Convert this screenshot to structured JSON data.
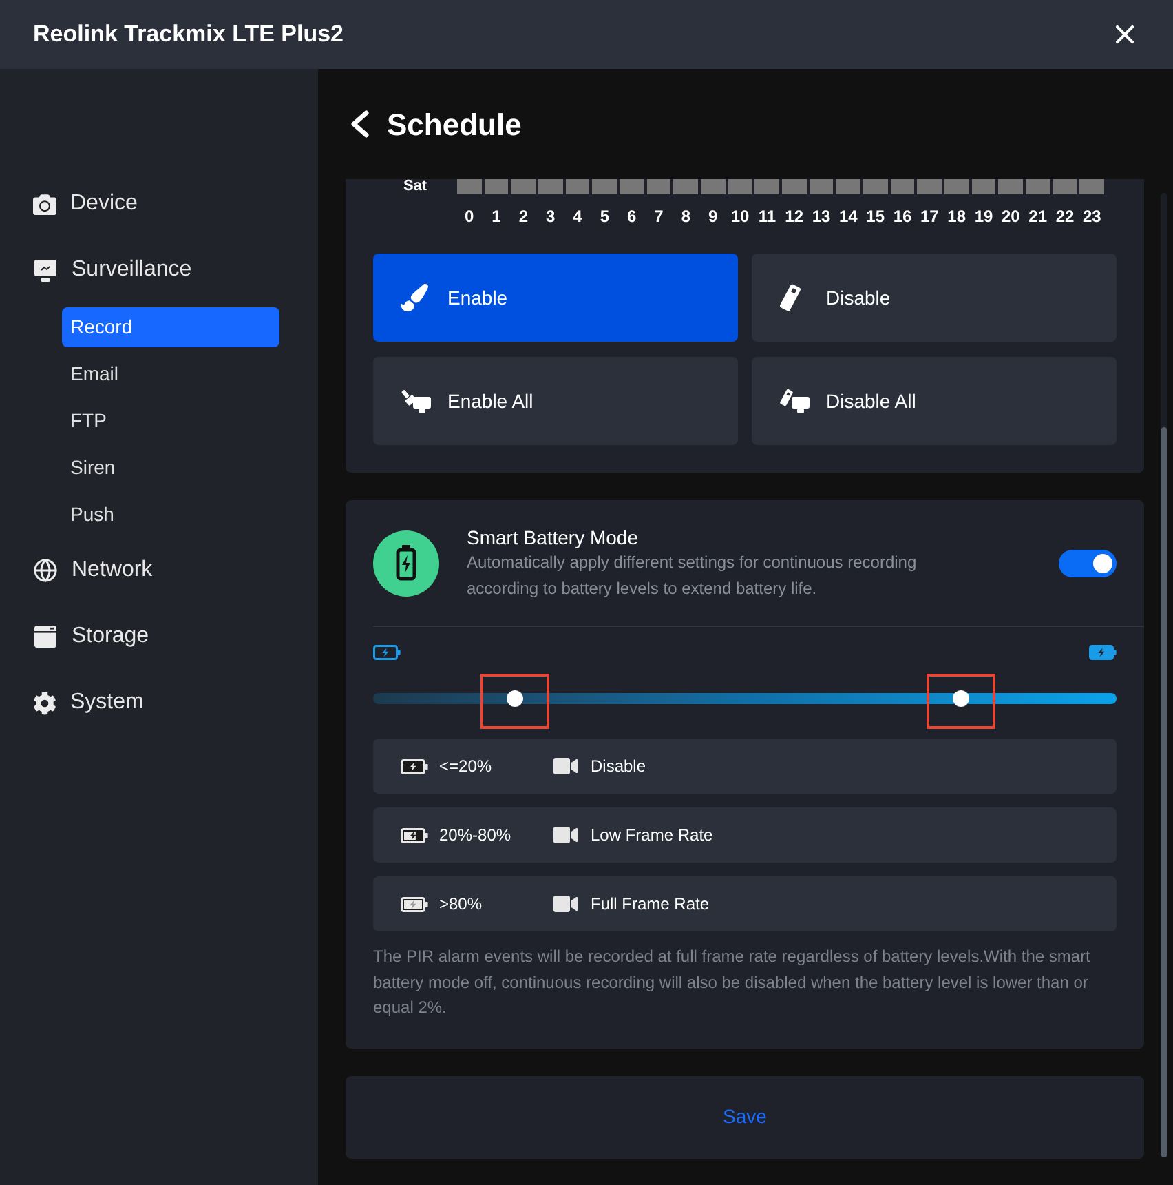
{
  "window": {
    "title": "Reolink Trackmix LTE Plus2"
  },
  "sidebar": {
    "items": [
      {
        "label": "Device"
      },
      {
        "label": "Surveillance",
        "children": [
          {
            "label": "Record",
            "selected": true
          },
          {
            "label": "Email",
            "selected": false
          },
          {
            "label": "FTP",
            "selected": false
          },
          {
            "label": "Siren",
            "selected": false
          },
          {
            "label": "Push",
            "selected": false
          }
        ]
      },
      {
        "label": "Network"
      },
      {
        "label": "Storage"
      },
      {
        "label": "System"
      }
    ]
  },
  "page": {
    "title": "Schedule"
  },
  "schedule": {
    "day": "Sat",
    "slots": [
      {
        "on": false
      },
      {
        "on": false
      },
      {
        "on": false
      },
      {
        "on": false
      },
      {
        "on": false
      },
      {
        "on": false
      },
      {
        "on": false
      },
      {
        "on": false
      },
      {
        "on": false
      },
      {
        "on": false
      },
      {
        "on": false
      },
      {
        "on": false
      },
      {
        "on": false
      },
      {
        "on": false
      },
      {
        "on": false
      },
      {
        "on": false
      },
      {
        "on": false
      },
      {
        "on": false
      },
      {
        "on": false
      },
      {
        "on": false
      },
      {
        "on": false
      },
      {
        "on": false
      },
      {
        "on": false
      },
      {
        "on": false
      }
    ],
    "hours": [
      "0",
      "1",
      "2",
      "3",
      "4",
      "5",
      "6",
      "7",
      "8",
      "9",
      "10",
      "11",
      "12",
      "13",
      "14",
      "15",
      "16",
      "17",
      "18",
      "19",
      "20",
      "21",
      "22",
      "23"
    ]
  },
  "mode_buttons": [
    {
      "label": "Enable",
      "selected": true
    },
    {
      "label": "Disable",
      "selected": false
    },
    {
      "label": "Enable All",
      "selected": false
    },
    {
      "label": "Disable All",
      "selected": false
    }
  ],
  "smart_battery": {
    "title": "Smart Battery Mode",
    "description": "Automatically apply different settings for continuous recording according to battery levels to extend battery life.",
    "on": true,
    "slider": {
      "thumbs": [
        {
          "level": 0.19
        },
        {
          "level": 0.79
        }
      ]
    },
    "tiers": [
      {
        "kind": "low",
        "range": "<=20%",
        "mode": "Disable"
      },
      {
        "kind": "medium",
        "range": "20%-80%",
        "mode": "Low Frame Rate"
      },
      {
        "kind": "high",
        "range": ">80%",
        "mode": "Full Frame Rate"
      }
    ],
    "note": "The PIR alarm events will be recorded at full frame rate regardless of battery levels.With the smart battery mode off, continuous recording will also be disabled when the battery level is lower than or equal 2%."
  },
  "save_button": {
    "label": "Save"
  }
}
